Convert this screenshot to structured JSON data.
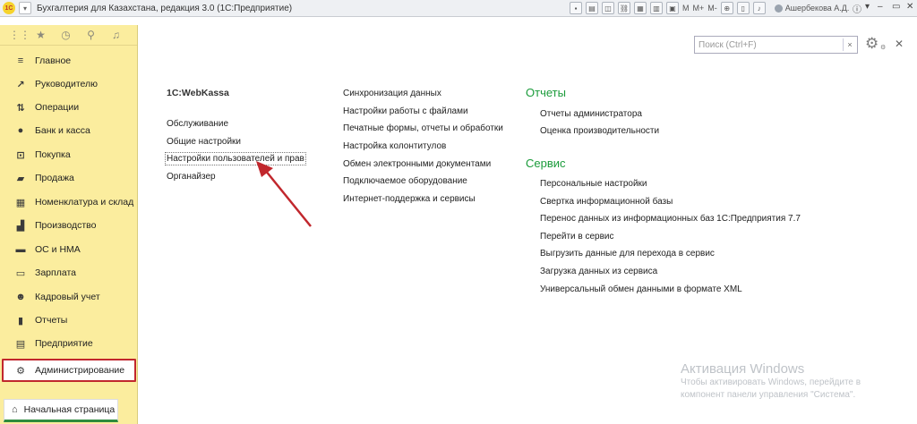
{
  "window": {
    "title": "Бухгалтерия для Казахстана, редакция 3.0  (1С:Предприятие)",
    "logo": "1С",
    "toolbar_m": "M",
    "toolbar_mplus": "M+",
    "toolbar_mminus": "M-",
    "user": "Ашербекова А.Д."
  },
  "sidebar": {
    "items": [
      {
        "label": "Главное",
        "icon": "menu-lines-icon"
      },
      {
        "label": "Руководителю",
        "icon": "trend-icon"
      },
      {
        "label": "Операции",
        "icon": "operations-icon"
      },
      {
        "label": "Банк и касса",
        "icon": "coin-icon"
      },
      {
        "label": "Покупка",
        "icon": "cart-icon"
      },
      {
        "label": "Продажа",
        "icon": "bag-icon"
      },
      {
        "label": "Номенклатура и склад",
        "icon": "warehouse-icon"
      },
      {
        "label": "Производство",
        "icon": "factory-icon"
      },
      {
        "label": "ОС и НМА",
        "icon": "truck-icon"
      },
      {
        "label": "Зарплата",
        "icon": "money-icon"
      },
      {
        "label": "Кадровый учет",
        "icon": "people-icon"
      },
      {
        "label": "Отчеты",
        "icon": "bar-chart-icon"
      },
      {
        "label": "Предприятие",
        "icon": "building-icon"
      },
      {
        "label": "Администрирование",
        "icon": "gear-icon"
      }
    ],
    "home_tab": "Начальная страница"
  },
  "search": {
    "placeholder": "Поиск (Ctrl+F)",
    "clear": "×"
  },
  "col1": {
    "heading": "1C:WebKassa",
    "links": [
      "Обслуживание",
      "Общие настройки",
      "Настройки пользователей и прав",
      "Органайзер"
    ]
  },
  "col2": {
    "links": [
      "Синхронизация данных",
      "Настройки работы с файлами",
      "Печатные формы, отчеты и обработки",
      "Настройка колонтитулов",
      "Обмен электронными документами",
      "Подключаемое оборудование",
      "Интернет-поддержка и сервисы"
    ]
  },
  "col3": {
    "reports_title": "Отчеты",
    "reports": [
      "Отчеты администратора",
      "Оценка производительности"
    ],
    "service_title": "Сервис",
    "service": [
      "Персональные настройки",
      "Свертка информационной базы",
      "Перенос данных из информационных баз 1С:Предприятия 7.7",
      "Перейти в сервис",
      "Выгрузить данные для перехода в сервис",
      "Загрузка данных из сервиса",
      "Универсальный обмен данными в формате XML"
    ]
  },
  "activation": {
    "title": "Активация Windows",
    "line1": "Чтобы активировать Windows, перейдите в",
    "line2": "компонент панели управления \"Система\"."
  },
  "colors": {
    "sidebar_bg": "#fbed9e",
    "accent_red": "#c1272d",
    "section_green": "#1a9b3a",
    "tab_green": "#2e8b3e"
  }
}
